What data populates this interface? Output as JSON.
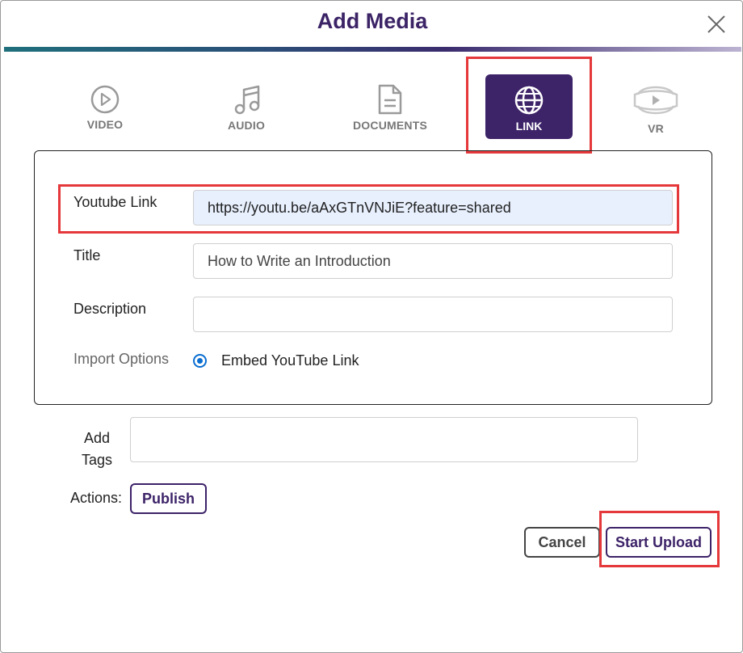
{
  "dialog": {
    "title": "Add Media",
    "close_icon": "close-icon"
  },
  "tabs": [
    {
      "label": "VIDEO",
      "icon": "video-play-icon",
      "active": false
    },
    {
      "label": "AUDIO",
      "icon": "music-note-icon",
      "active": false
    },
    {
      "label": "DOCUMENTS",
      "icon": "document-icon",
      "active": false
    },
    {
      "label": "LINK",
      "icon": "globe-icon",
      "active": true
    },
    {
      "label": "VR",
      "icon": "vr-headset-icon",
      "active": false
    }
  ],
  "form": {
    "youtube_link_label": "Youtube Link",
    "youtube_link_value": "https://youtu.be/aAxGTnVNJiE?feature=shared",
    "title_label": "Title",
    "title_value": "How to Write an Introduction",
    "description_label": "Description",
    "description_value": "",
    "import_options_label": "Import Options",
    "import_option_embed": "Embed YouTube Link"
  },
  "tags": {
    "label_line1": "Add",
    "label_line2": "Tags",
    "value": ""
  },
  "actions": {
    "label": "Actions:",
    "publish_label": "Publish"
  },
  "footer": {
    "cancel_label": "Cancel",
    "start_upload_label": "Start Upload"
  },
  "colors": {
    "brand_purple": "#3d2368",
    "highlight_red": "#e5383b",
    "radio_blue": "#0a6ed1"
  }
}
